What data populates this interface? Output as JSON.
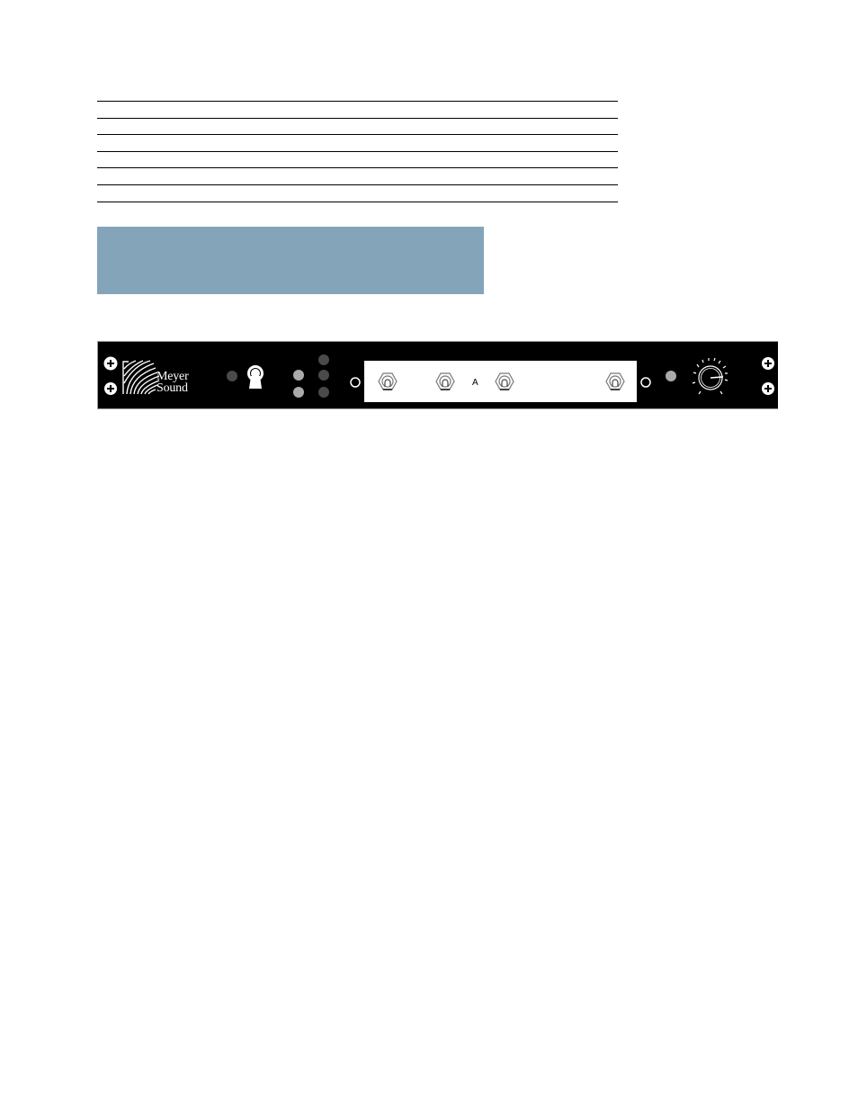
{
  "document": {
    "table_rule_count": 7,
    "note_box": {
      "text": "",
      "color": "#84a4ba"
    }
  },
  "front_panel": {
    "brand": {
      "line1": "Meyer",
      "line2": "Sound"
    },
    "input_label": "A",
    "colors": {
      "panel": "#000000",
      "window": "#ffffff",
      "led_light": "#aaaaaa",
      "led_dark": "#4a4a4a"
    },
    "knob_level": 0.85,
    "indicators": [
      {
        "name": "led-power",
        "state": "dark"
      },
      {
        "name": "led-a",
        "state": "light"
      },
      {
        "name": "led-b",
        "state": "light"
      },
      {
        "name": "led-c",
        "state": "dark"
      },
      {
        "name": "led-d",
        "state": "dark"
      },
      {
        "name": "led-e",
        "state": "dark"
      },
      {
        "name": "led-right",
        "state": "light"
      }
    ]
  }
}
